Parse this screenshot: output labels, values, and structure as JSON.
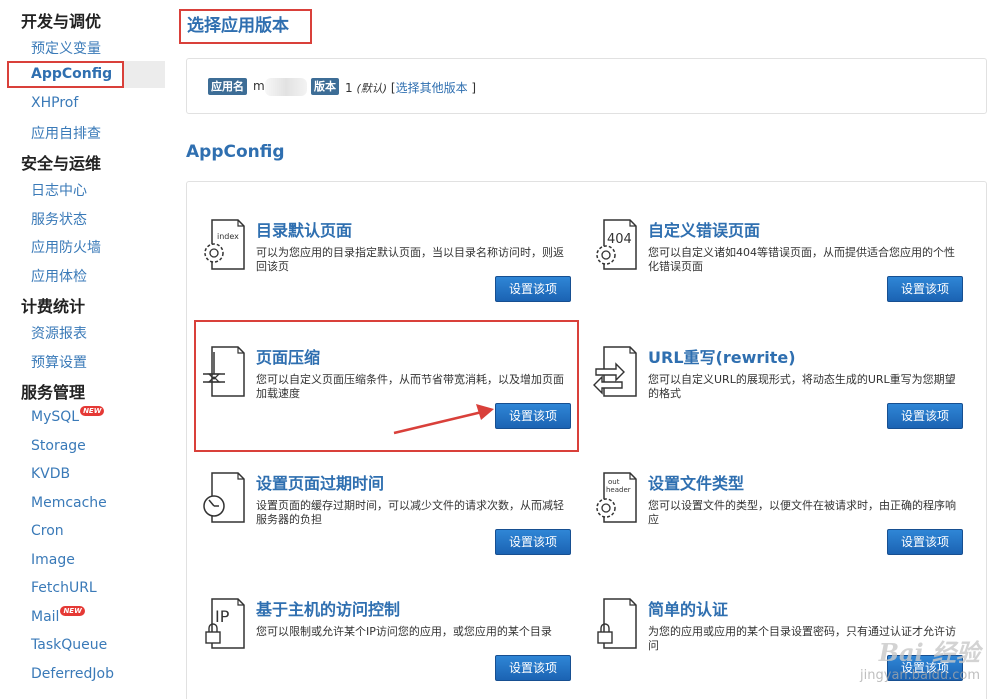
{
  "sidebar": {
    "sections": [
      {
        "title": "开发与调优",
        "items": [
          "预定义变量",
          "AppConfig",
          "XHProf",
          "应用自排查"
        ]
      },
      {
        "title": "安全与运维",
        "items": [
          "日志中心",
          "服务状态",
          "应用防火墙",
          "应用体检"
        ]
      },
      {
        "title": "计费统计",
        "items": [
          "资源报表",
          "预算设置"
        ]
      },
      {
        "title": "服务管理",
        "items": [
          "MySQL",
          "Storage",
          "KVDB",
          "Memcache",
          "Cron",
          "Image",
          "FetchURL",
          "Mail",
          "TaskQueue",
          "DeferredJob"
        ]
      }
    ],
    "new_badge": "NEW",
    "active_item": "AppConfig"
  },
  "version": {
    "title": "选择应用版本",
    "app_label": "应用名",
    "app_name": "m",
    "version_label": "版本",
    "version_number": "1",
    "default_text": "(默认)",
    "other_versions_link": "选择其他版本",
    "bracket_open": "[",
    "bracket_close": "]"
  },
  "main": {
    "heading": "AppConfig",
    "button_label": "设置该项",
    "cards": [
      {
        "title": "目录默认页面",
        "desc": "可以为您应用的目录指定默认页面，当以目录名称访问时，则返回该页",
        "icon": "index-gear-icon",
        "icon_text": "index"
      },
      {
        "title": "自定义错误页面",
        "desc": "您可以自定义诸如404等错误页面，从而提供适合您应用的个性化错误页面",
        "icon": "404-gear-icon",
        "icon_text": "404"
      },
      {
        "title": "页面压缩",
        "desc": "您可以自定义页面压缩条件，从而节省带宽消耗，以及增加页面加载速度",
        "icon": "compress-icon",
        "icon_text": ""
      },
      {
        "title": "URL重写(rewrite)",
        "desc": "您可以自定义URL的展现形式，将动态生成的URL重写为您期望的格式",
        "icon": "rewrite-arrows-icon",
        "icon_text": ""
      },
      {
        "title": "设置页面过期时间",
        "desc": "设置页面的缓存过期时间，可以减少文件的请求次数，从而减轻服务器的负担",
        "icon": "clock-icon",
        "icon_text": ""
      },
      {
        "title": "设置文件类型",
        "desc": "您可以设置文件的类型，以便文件在被请求时，由正确的程序响应",
        "icon": "header-gear-icon",
        "icon_text": "out header"
      },
      {
        "title": "基于主机的访问控制",
        "desc": "您可以限制或允许某个IP访问您的应用，或您应用的某个目录",
        "icon": "ip-lock-icon",
        "icon_text": "IP"
      },
      {
        "title": "简单的认证",
        "desc": "为您的应用或应用的某个目录设置密码，只有通过认证才允许访问",
        "icon": "lock-icon",
        "icon_text": ""
      }
    ]
  },
  "watermark": {
    "logo": "Bai 经验",
    "url": "jingyan.baidu.com"
  }
}
